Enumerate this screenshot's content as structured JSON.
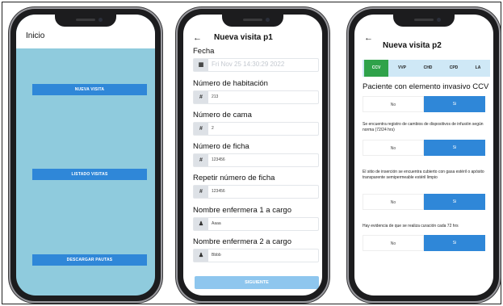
{
  "screen1": {
    "title": "Inicio",
    "buttons": [
      "NUEVA VISITA",
      "LISTADO VISITAS",
      "DESCARGAR PAUTAS"
    ]
  },
  "screen2": {
    "title": "Nueva visita p1",
    "back_icon": "arrow-left-icon",
    "fields": [
      {
        "label": "Fecha",
        "icon": "calendar-icon",
        "glyph": "▦",
        "value": "Fri Nov 25 14:30:29 2022"
      },
      {
        "label": "Número de habitación",
        "icon": "hash-icon",
        "glyph": "#",
        "value": "213"
      },
      {
        "label": "Número de cama",
        "icon": "hash-icon",
        "glyph": "#",
        "value": "2"
      },
      {
        "label": "Número de ficha",
        "icon": "hash-icon",
        "glyph": "#",
        "value": "123456"
      },
      {
        "label": "Repetir número de ficha",
        "icon": "hash-icon",
        "glyph": "#",
        "value": "123456"
      },
      {
        "label": "Nombre enfermera 1 a cargo",
        "icon": "person-icon",
        "glyph": "♟",
        "value": "Aaaa"
      },
      {
        "label": "Nombre enfermera 2 a cargo",
        "icon": "person-icon",
        "glyph": "♟",
        "value": "Bbbb"
      }
    ],
    "next_button": "SIGUIENTE"
  },
  "screen3": {
    "title": "Nueva visita p2",
    "back_icon": "arrow-left-icon",
    "tabs": [
      "CCV",
      "VVP",
      "CHD",
      "CPD",
      "LA"
    ],
    "active_tab": "CCV",
    "section_title": "Paciente con elemento invasivo CCV",
    "questions": [
      {
        "text": "",
        "no": "No",
        "yes": "Si",
        "selected": "Si"
      },
      {
        "text": "Se encuentra registro de cambios de dispositivos de infusión según norma (72/24 hrs)",
        "no": "No",
        "yes": "Si",
        "selected": "Si"
      },
      {
        "text": "El sitio de inserción se encuentra cubierto con gasa estéril o apósito transparente semipermeable estéril limpio",
        "no": "No",
        "yes": "Si",
        "selected": "Si"
      },
      {
        "text": "Hay evidencia de que se realiza curación cada 72 hrs",
        "no": "No",
        "yes": "Si",
        "selected": "Si"
      }
    ]
  },
  "colors": {
    "home_background": "#8fcbdd",
    "primary_button": "#2f87d8",
    "active_tab": "#2fa24a",
    "tab_bar": "#cfe8f6",
    "next_button": "#8ec6ee"
  }
}
